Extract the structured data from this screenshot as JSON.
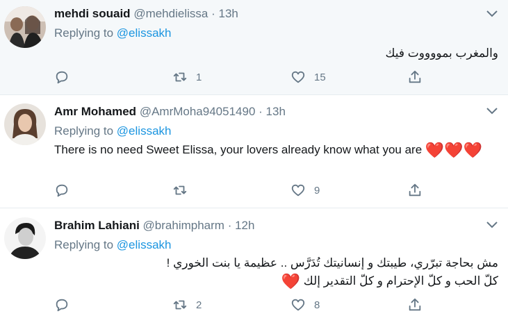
{
  "tweets": [
    {
      "name": "mehdi souaid",
      "handle": "@mehdielissa",
      "time": "13h",
      "replying_prefix": "Replying to",
      "replying_to": "@elissakh",
      "text": "والمغرب بمووووت فيك",
      "hearts": "",
      "reply_count": "",
      "retweet_count": "1",
      "like_count": "15"
    },
    {
      "name": "Amr Mohamed",
      "handle": "@AmrMoha94051490",
      "time": "13h",
      "replying_prefix": "Replying to",
      "replying_to": "@elissakh",
      "text": "There is no need Sweet Elissa, your lovers already know what you are ",
      "hearts": "❤️❤️❤️",
      "reply_count": "",
      "retweet_count": "",
      "like_count": "9"
    },
    {
      "name": "Brahim Lahiani",
      "handle": "@brahimpharm",
      "time": "12h",
      "replying_prefix": "Replying to",
      "replying_to": "@elissakh",
      "text_line1": "مش بحاجة تبرّري، طيبتك و إنسانيتك تُدَرَّس .. عظيمة يا بنت الخوري !",
      "text_line2": "كلّ الحب و كلّ الإحترام و كلّ التقدير إلك ",
      "hearts": "❤️",
      "reply_count": "",
      "retweet_count": "2",
      "like_count": "8"
    }
  ],
  "separator": "·",
  "colors": {
    "link": "#1b95e0",
    "muted": "#657786",
    "heart": "#e0245e",
    "highlight_bg": "#f5f8fa"
  },
  "icons": [
    "reply-icon",
    "retweet-icon",
    "like-icon",
    "share-icon",
    "chevron-down-icon"
  ]
}
